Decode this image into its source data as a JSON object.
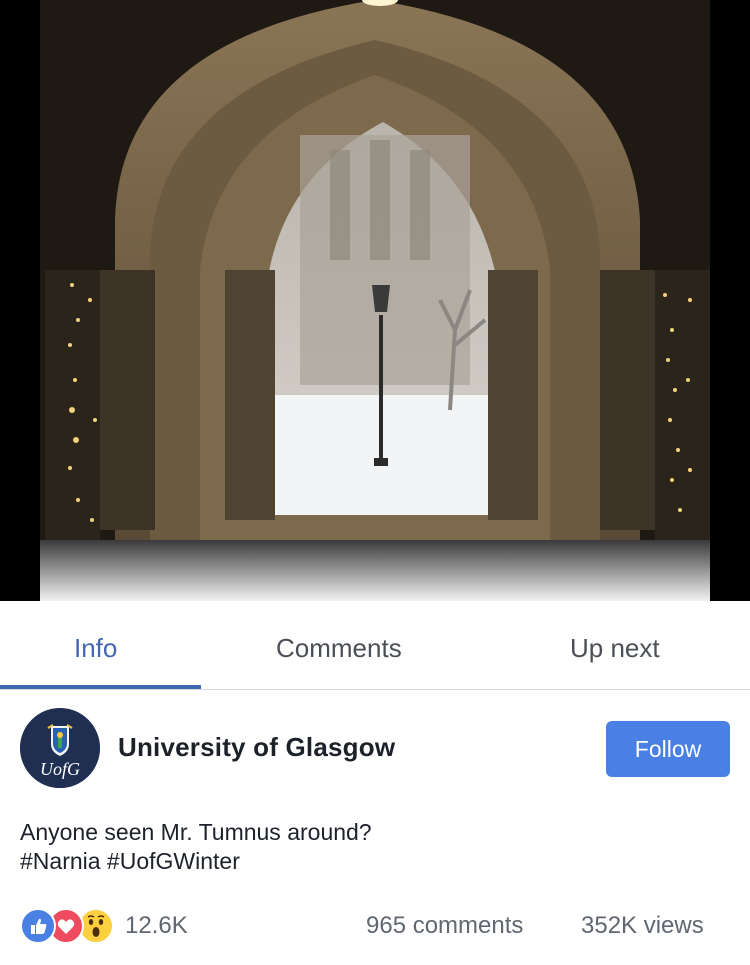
{
  "tabs": {
    "info": "Info",
    "comments": "Comments",
    "up_next": "Up next",
    "active": "info"
  },
  "page": {
    "name": "University of Glasgow",
    "avatar_text": "UofG",
    "follow_label": "Follow"
  },
  "post": {
    "line1": "Anyone seen Mr. Tumnus around?",
    "line2": "#Narnia #UofGWinter"
  },
  "stats": {
    "reactions_count": "12.6K",
    "comments": "965 comments",
    "views": "352K views",
    "reaction_icons": [
      "like-icon",
      "love-icon",
      "wow-icon"
    ]
  },
  "colors": {
    "accent": "#4267b2",
    "follow_button": "#4a7fe4",
    "avatar_bg": "#1f2f52"
  }
}
